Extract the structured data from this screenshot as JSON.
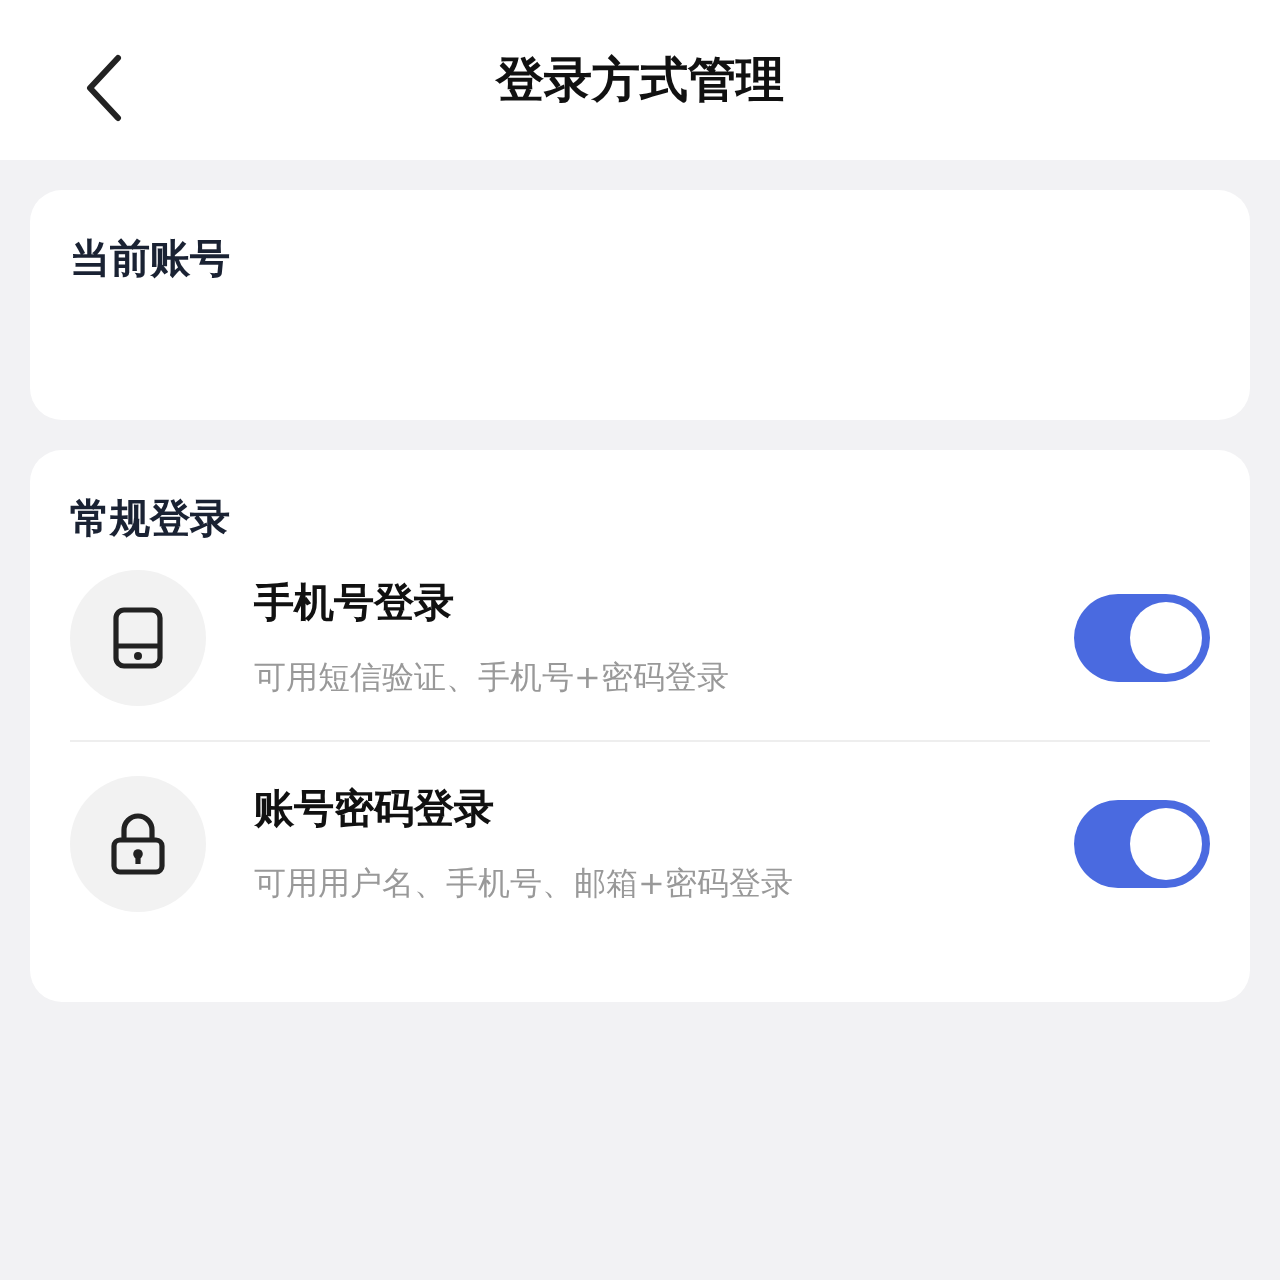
{
  "header": {
    "title": "登录方式管理"
  },
  "current_account": {
    "title": "当前账号"
  },
  "section": {
    "title": "常规登录",
    "methods": [
      {
        "kind": "phone",
        "title": "手机号登录",
        "description": "可用短信验证、手机号+密码登录",
        "on": true
      },
      {
        "kind": "lock",
        "title": "账号密码登录",
        "description": "可用用户名、手机号、邮箱+密码登录",
        "on": true
      }
    ]
  }
}
